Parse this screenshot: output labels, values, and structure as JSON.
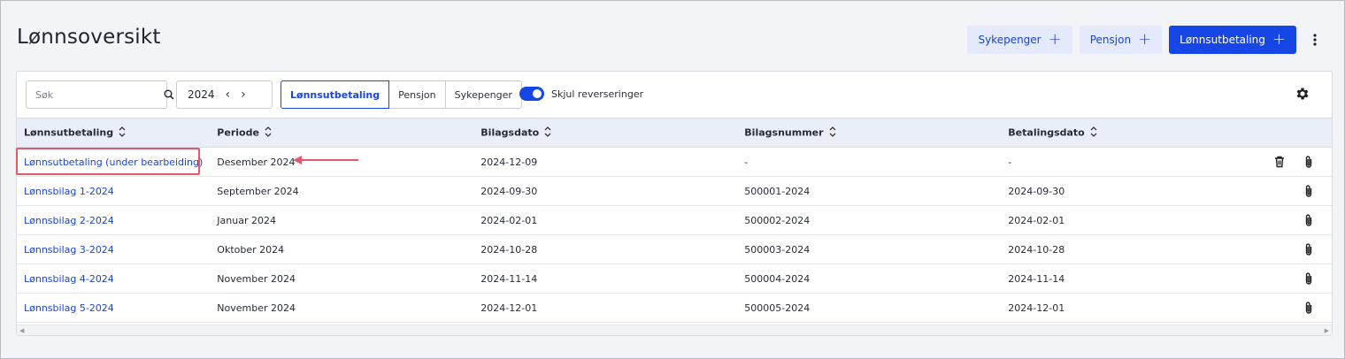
{
  "header": {
    "title": "Lønnsoversikt",
    "actions": [
      {
        "label": "Sykepenger",
        "style": "light"
      },
      {
        "label": "Pensjon",
        "style": "light"
      },
      {
        "label": "Lønnsutbetaling",
        "style": "primary"
      }
    ]
  },
  "toolbar": {
    "search_placeholder": "Søk",
    "year": "2024",
    "segments": [
      {
        "label": "Lønnsutbetaling",
        "active": true
      },
      {
        "label": "Pensjon",
        "active": false
      },
      {
        "label": "Sykepenger",
        "active": false
      }
    ],
    "toggle_label": "Skjul reverseringer",
    "toggle_on": true
  },
  "table": {
    "columns": [
      "Lønnsutbetaling",
      "Periode",
      "Bilagsdato",
      "Bilagsnummer",
      "Betalingsdato"
    ],
    "rows": [
      {
        "name": "Lønnsutbetaling (under bearbeiding)",
        "periode": "Desember 2024",
        "bilagsdato": "2024-12-09",
        "bilagsnummer": "-",
        "betalingsdato": "-",
        "delete": true
      },
      {
        "name": "Lønnsbilag 1-2024",
        "periode": "September 2024",
        "bilagsdato": "2024-09-30",
        "bilagsnummer": "500001-2024",
        "betalingsdato": "2024-09-30",
        "delete": false
      },
      {
        "name": "Lønnsbilag 2-2024",
        "periode": "Januar 2024",
        "bilagsdato": "2024-02-01",
        "bilagsnummer": "500002-2024",
        "betalingsdato": "2024-02-01",
        "delete": false
      },
      {
        "name": "Lønnsbilag 3-2024",
        "periode": "Oktober 2024",
        "bilagsdato": "2024-10-28",
        "bilagsnummer": "500003-2024",
        "betalingsdato": "2024-10-28",
        "delete": false
      },
      {
        "name": "Lønnsbilag 4-2024",
        "periode": "November 2024",
        "bilagsdato": "2024-11-14",
        "bilagsnummer": "500004-2024",
        "betalingsdato": "2024-11-14",
        "delete": false
      },
      {
        "name": "Lønnsbilag 5-2024",
        "periode": "November 2024",
        "bilagsdato": "2024-12-01",
        "bilagsnummer": "500005-2024",
        "betalingsdato": "2024-12-01",
        "delete": false
      }
    ]
  },
  "colors": {
    "primary": "#1646e6",
    "light_button": "#e4e9fb",
    "highlight": "#e35a6a",
    "link": "#1a45d6"
  },
  "icons": {
    "kebab": "more-vertical-icon",
    "search": "search-icon",
    "gear": "gear-icon",
    "trash": "trash-icon",
    "attachment": "paperclip-icon",
    "sort": "sort-icon"
  }
}
